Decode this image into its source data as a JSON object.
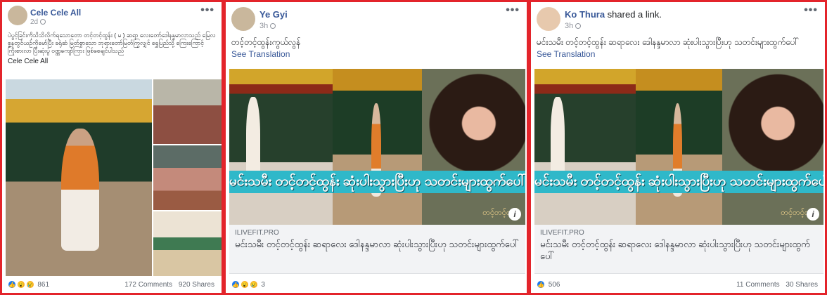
{
  "panel1": {
    "author": "Cele Cele All",
    "time": "2d",
    "text": "ပဲပွင့်ခြင်းကိုသိသိလိုက်ရသောတော တင့်တင့်ထွန်း ( မ ) ဆရာ လေးတော်ဒေါနန္ဒမာလာသည် မြေလစ္စနတွင်ယဉ်ကိုမော်ပြီး ခရုံဆံ မြတ်စွာသော ဘုရားတော်မြတ်ကြွလျှင် ရွှေပြည်သို့ ကြေးကြောင့် ကြိုးစားလာ ပြီးဆုံးပွဲ ဝဏ္ဏကျော်ကြား ဖြစ်စေချင်ပါသည်",
    "signature": "Cele Cele All",
    "reaction_count": "861",
    "comments": "172 Comments",
    "shares": "920 Shares"
  },
  "panel2": {
    "author": "Ye Gyi",
    "time": "3h",
    "text": "တင့်တင့်ထွန်းကွယ်လွန်",
    "see_translation": "See Translation",
    "banner": "မင်းသမီး တင့်တင့်ထွန်း ဆုံးပါးသွားပြီးဟု သတင်းများထွက်ပေါ်",
    "watermark": "တင့်တင့်ထွန်း",
    "info": "i",
    "link_domain": "ILIVEFIT.PRO",
    "link_title": "မင်းသမီး တင့်တင့်ထွန်း ဆရာလေး ဒေါနန္ဒမာလာ ဆုံးပါးသွားပြီးဟု သတင်းများထွက်ပေါ်",
    "reaction_count": "3"
  },
  "panel3": {
    "author": "Ko Thura",
    "shared_text": " shared a link.",
    "time": "3h",
    "text": "မင်းသမီး တင့်တင့်ထွန်း ဆရာလေး ဒေါနန္ဒမာလာ ဆုံးပါးသွားပြီးဟု သတင်းများထွက်ပေါ်",
    "see_translation": "See Translation",
    "banner": "မင်းသမီး တင့်တင့်ထွန်း ဆုံးပါးသွားပြီးဟု သတင်းများထွက်ပေါ်",
    "watermark": "တင့်တင့်ထွန်း",
    "info": "i",
    "link_domain": "ILIVEFIT.PRO",
    "link_title": "မင်းသမီး တင့်တင့်ထွန်း ဆရာလေး ဒေါနန္ဒမာလာ ဆုံးပါးသွားပြီးဟု သတင်းများထွက်ပေါ်",
    "reaction_count": "506",
    "comments": "11 Comments",
    "shares": "30 Shares"
  },
  "icons": {
    "more": "•••",
    "like": "👍",
    "wow": "😮",
    "sad": "😢"
  },
  "colors": {
    "frame_red": "#e3242b",
    "link_blue": "#385898",
    "banner_cyan": "#2fb8c9",
    "like_blue": "#1877f2"
  }
}
